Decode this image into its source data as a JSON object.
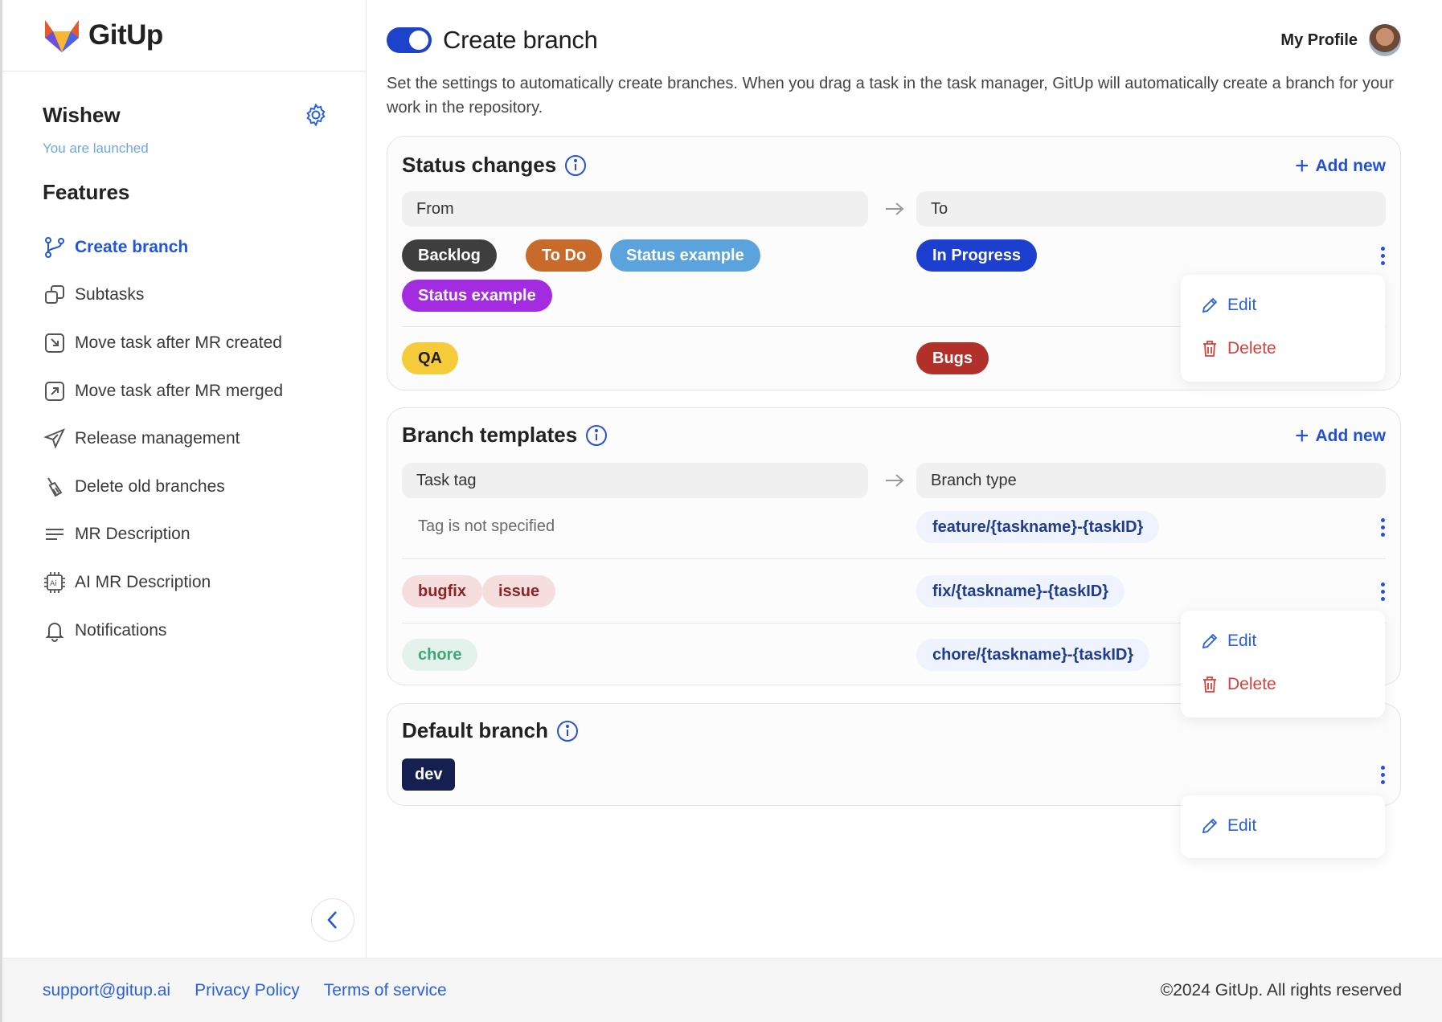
{
  "app": {
    "name": "GitUp"
  },
  "sidebar": {
    "project_name": "Wishew",
    "project_status": "You are launched",
    "features_title": "Features",
    "items": [
      {
        "label": "Create branch",
        "icon": "branch-icon"
      },
      {
        "label": "Subtasks",
        "icon": "subtasks-icon"
      },
      {
        "label": "Move task after MR created",
        "icon": "move-in-icon"
      },
      {
        "label": "Move task after MR merged",
        "icon": "move-out-icon"
      },
      {
        "label": "Release management",
        "icon": "paper-plane-icon"
      },
      {
        "label": "Delete old branches",
        "icon": "broom-icon"
      },
      {
        "label": "MR Description",
        "icon": "lines-icon"
      },
      {
        "label": "AI MR Description",
        "icon": "ai-chip-icon"
      },
      {
        "label": "Notifications",
        "icon": "bell-icon"
      }
    ]
  },
  "header": {
    "title": "Create branch",
    "toggle_on": true,
    "profile_label": "My Profile",
    "description": "Set the settings to automatically create branches. When you drag a task in the task manager, GitUp will automatically create a branch for your work in the repository."
  },
  "status_changes": {
    "title": "Status changes",
    "add_new": "Add new",
    "from_label": "From",
    "to_label": "To",
    "rows": [
      {
        "from": [
          {
            "label": "Backlog",
            "bg": "#3e3e3e",
            "fg": "#ffffff"
          },
          {
            "label": "To Do",
            "bg": "#c76a2a",
            "fg": "#ffffff"
          },
          {
            "label": "Status example",
            "bg": "#5ba3dc",
            "fg": "#ffffff"
          },
          {
            "label": "Status example",
            "bg": "#a32be0",
            "fg": "#ffffff"
          }
        ],
        "to": {
          "label": "In Progress",
          "bg": "#1d3fd0",
          "fg": "#ffffff"
        }
      },
      {
        "from": [
          {
            "label": "QA",
            "bg": "#f5cb3a",
            "fg": "#222222"
          }
        ],
        "to": {
          "label": "Bugs",
          "bg": "#b2302a",
          "fg": "#ffffff"
        }
      }
    ],
    "menu": {
      "edit": "Edit",
      "delete": "Delete"
    }
  },
  "branch_templates": {
    "title": "Branch templates",
    "add_new": "Add new",
    "tag_label": "Task tag",
    "type_label": "Branch type",
    "rows": [
      {
        "tags": [],
        "empty_text": "Tag is not specified",
        "template": "feature/{taskname}-{taskID}"
      },
      {
        "tags": [
          {
            "label": "bugfix",
            "bg": "#f6dede",
            "fg": "#8e2323"
          },
          {
            "label": "issue",
            "bg": "#f6dede",
            "fg": "#8e2323"
          }
        ],
        "template": "fix/{taskname}-{taskID}"
      },
      {
        "tags": [
          {
            "label": "chore",
            "bg": "#e3f3ec",
            "fg": "#3fa774"
          }
        ],
        "template": "chore/{taskname}-{taskID}"
      }
    ],
    "menu": {
      "edit": "Edit",
      "delete": "Delete"
    }
  },
  "default_branch": {
    "title": "Default branch",
    "value": "dev",
    "menu": {
      "edit": "Edit"
    }
  },
  "footer": {
    "support": "support@gitup.ai",
    "privacy": "Privacy Policy",
    "terms": "Terms of service",
    "copyright": "©2024 GitUp. All rights reserved"
  },
  "colors": {
    "accent": "#2351d6",
    "toggle": "#1c43c9",
    "danger": "#d5413a",
    "template_chip_bg": "#eef3fd",
    "template_chip_fg": "#1f3c8f",
    "default_branch_bg": "#152050"
  }
}
